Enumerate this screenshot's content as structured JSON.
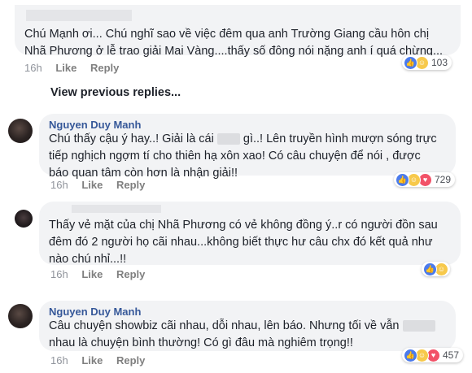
{
  "comment1": {
    "text_line1": "Chú Mạnh ơi... Chú nghĩ sao về việc đêm qua anh Trường Giang cầu hôn chị",
    "text_line2": "Nhã Phương ở lễ trao giải Mai Vàng....thấy số đông nói nặng anh í quá chừng...",
    "time": "16h",
    "like": "Like",
    "reply": "Reply",
    "reaction_count": "103",
    "reaction_icons": [
      "like-icon",
      "haha-icon"
    ]
  },
  "view_previous": "View previous replies...",
  "reply1": {
    "name": "Nguyen Duy Manh",
    "line1_a": "Chú thấy cậu ý hay..! Giải là cái",
    "line1_b": "gì..! Lên truyền hình mượn sóng trực",
    "line2": "tiếp nghịch ngợm tí cho thiên hạ xôn xao! Có câu chuyện để nói , được",
    "line3": "báo quan tâm còn hơn là nhận giải!!",
    "time": "16h",
    "like": "Like",
    "reply": "Reply",
    "reaction_count": "729",
    "reaction_icons": [
      "like-icon",
      "haha-icon",
      "love-icon"
    ]
  },
  "reply2": {
    "line1": "Thấy vẻ mặt của chị Nhã Phương có vẻ không đồng ý..r có người đồn sau",
    "line2": "đêm đó 2 người họ cãi nhau...không biết thực hư câu chx đó kết quả như",
    "line3": "nào chú nhỉ...!!",
    "time": "16h",
    "like": "Like",
    "reply": "Reply",
    "reaction_icons": [
      "like-icon",
      "haha-icon"
    ]
  },
  "reply3": {
    "name": "Nguyen Duy Manh",
    "line1": "Câu chuyện showbiz cãi nhau, dỗi nhau, lên báo. Nhưng tối về vẫn",
    "line2": "nhau là chuyện bình thường! Có gì đâu mà nghiêm trọng!!",
    "time": "16h",
    "like": "Like",
    "reply": "Reply",
    "reaction_count": "457",
    "reaction_icons": [
      "like-icon",
      "haha-icon",
      "love-icon"
    ]
  }
}
